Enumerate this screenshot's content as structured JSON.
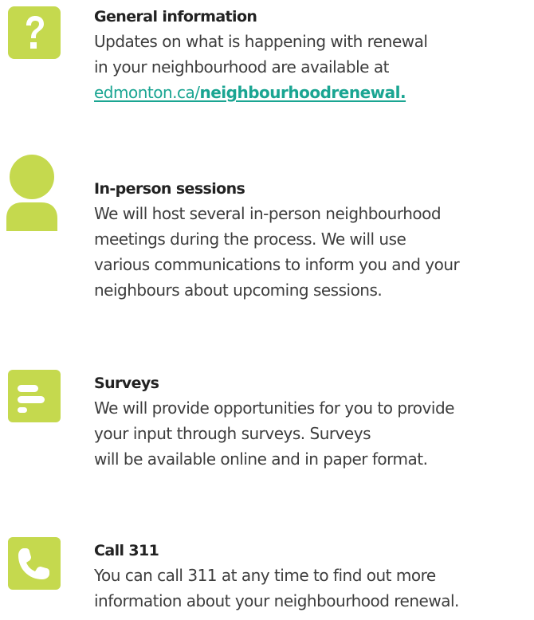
{
  "accent_color": "#c5d94e",
  "link_color": "#1aa592",
  "sections": [
    {
      "icon": "question-mark-icon",
      "title": "General information",
      "lines": [
        "Updates on what is happening with renewal",
        "in your neighbourhood are available at"
      ],
      "link": {
        "prefix": "edmonton.ca/",
        "bold": "neighbourhoodrenewal."
      }
    },
    {
      "icon": "person-icon",
      "title": "In-person sessions",
      "lines": [
        "We will host several in-person neighbourhood",
        "meetings during the process. We will use",
        "various communications to inform you and your",
        "neighbours about upcoming sessions."
      ]
    },
    {
      "icon": "survey-form-icon",
      "title": "Surveys",
      "lines": [
        "We will provide opportunities for you to provide",
        "your input through surveys. Surveys",
        "will be available online and in paper format."
      ]
    },
    {
      "icon": "phone-icon",
      "title": "Call 311",
      "lines": [
        "You can call 311 at any time to find out more",
        "information about your neighbourhood renewal."
      ]
    }
  ]
}
